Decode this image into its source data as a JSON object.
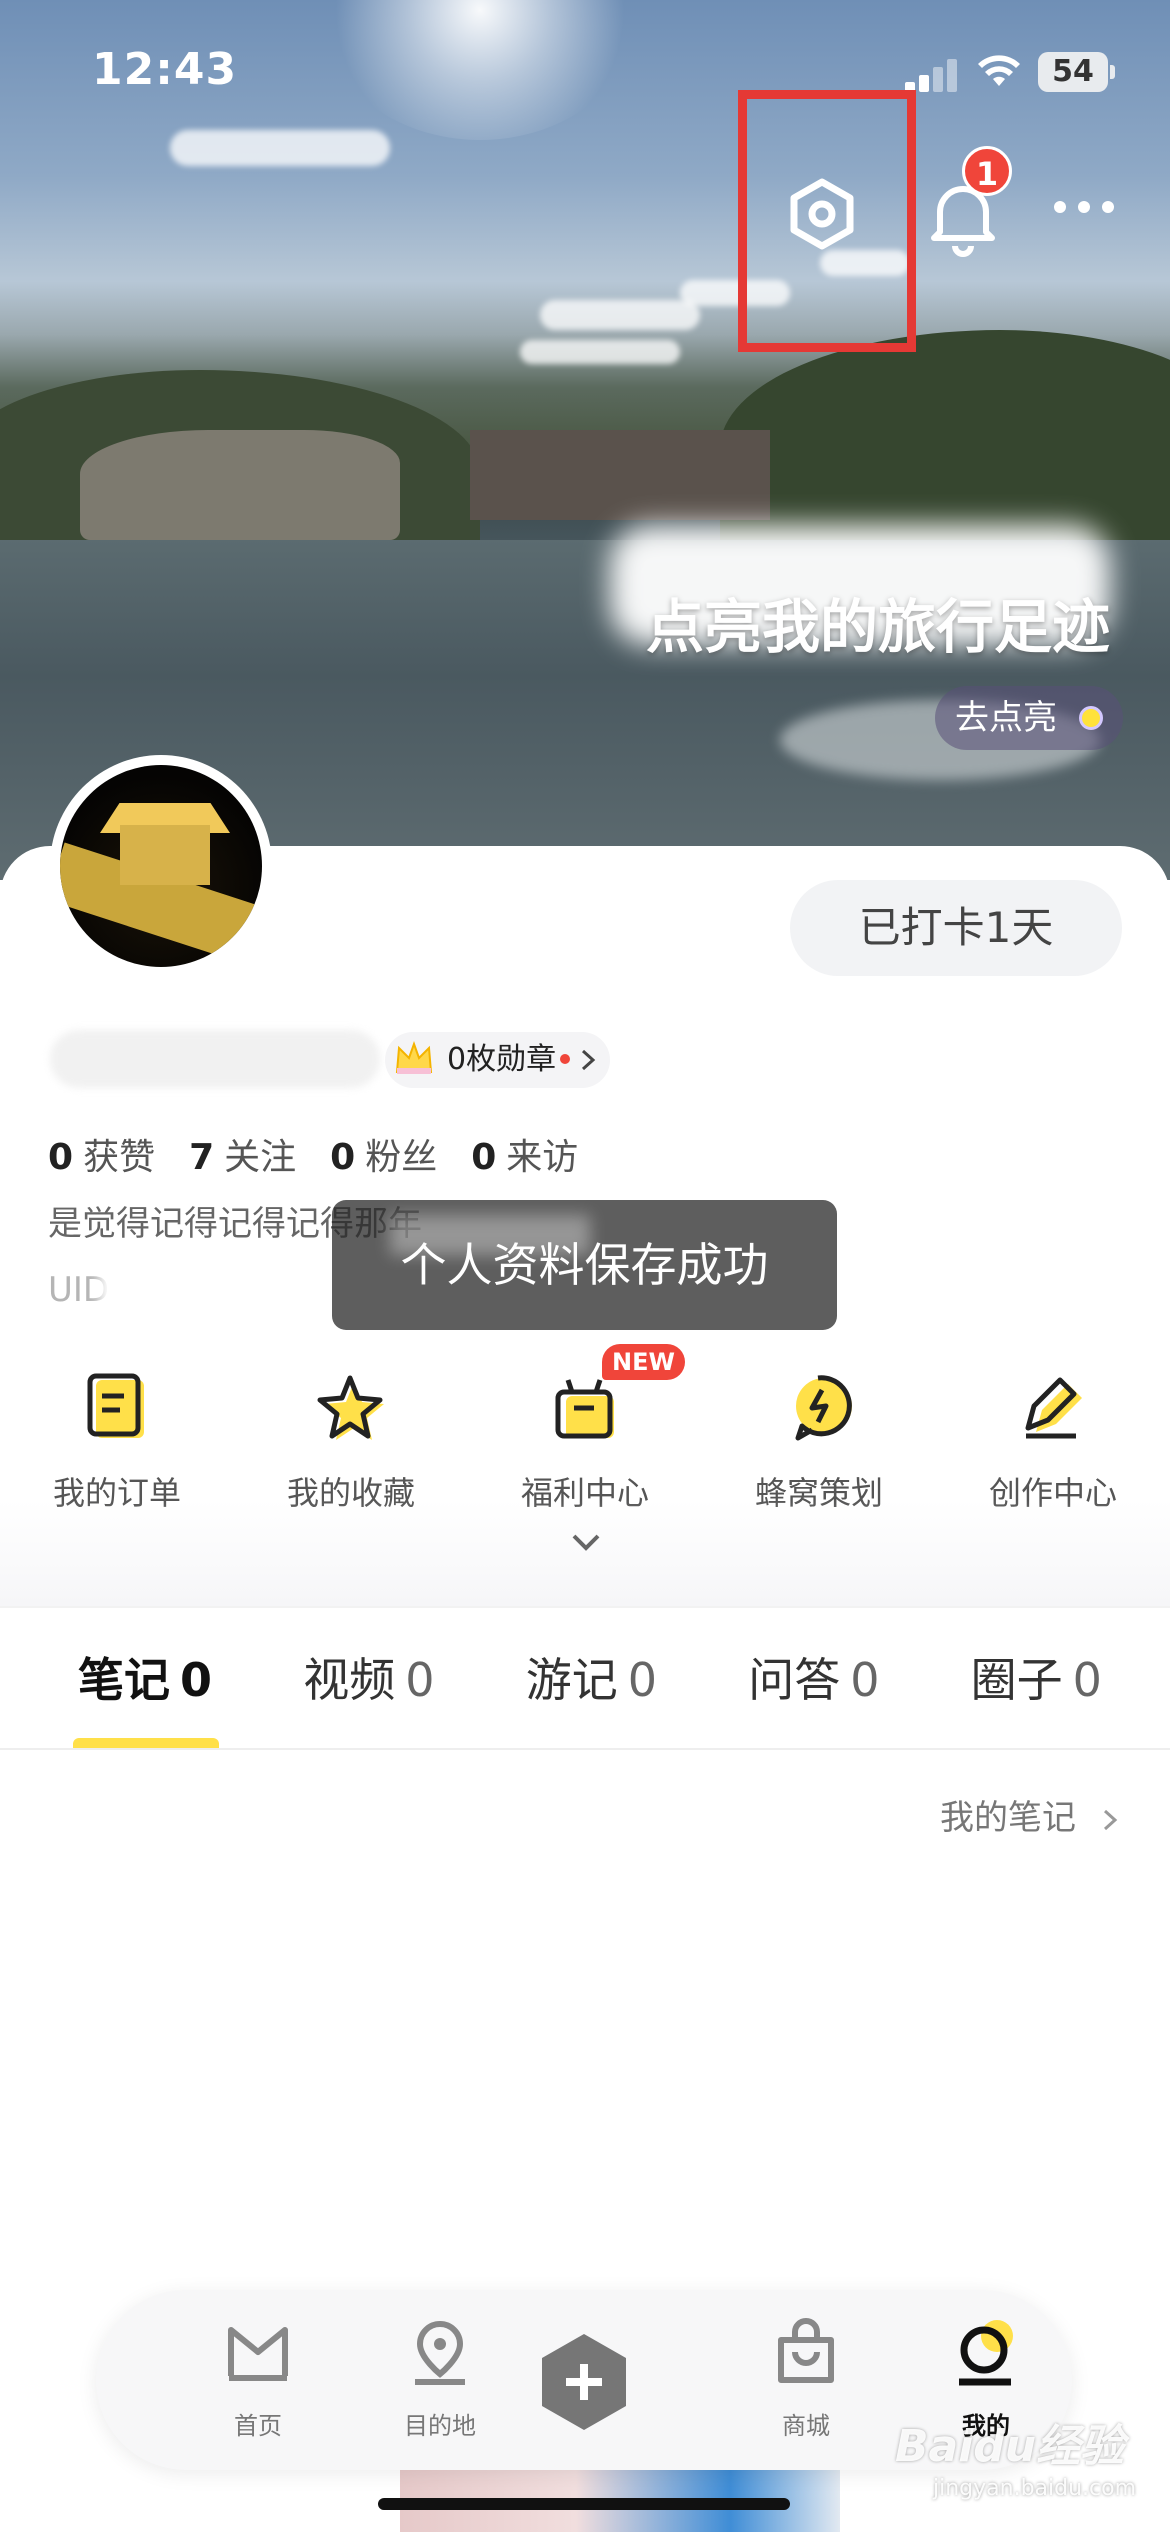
{
  "status_bar": {
    "time": "12:43",
    "battery": "54"
  },
  "header": {
    "notification_count": "1"
  },
  "hero": {
    "title": "点亮我的旅行足迹",
    "cta_label": "去点亮"
  },
  "profile": {
    "checkin_label": "已打卡1天",
    "medal_label": "0枚勋章",
    "stats": [
      {
        "value": "0",
        "label": "获赞"
      },
      {
        "value": "7",
        "label": "关注"
      },
      {
        "value": "0",
        "label": "粉丝"
      },
      {
        "value": "0",
        "label": "来访"
      }
    ],
    "bio": "是觉得记得记得记得那年",
    "uid_prefix": "UID"
  },
  "toast": {
    "message": "个人资料保存成功"
  },
  "quick_actions": [
    {
      "label": "我的订单",
      "icon": "order-icon"
    },
    {
      "label": "我的收藏",
      "icon": "star-icon"
    },
    {
      "label": "福利中心",
      "icon": "gift-icon",
      "badge": "NEW"
    },
    {
      "label": "蜂窝策划",
      "icon": "bee-icon"
    },
    {
      "label": "创作中心",
      "icon": "pen-icon"
    }
  ],
  "tabs": [
    {
      "label": "笔记",
      "count": "0",
      "active": true
    },
    {
      "label": "视频",
      "count": "0"
    },
    {
      "label": "游记",
      "count": "0"
    },
    {
      "label": "问答",
      "count": "0"
    },
    {
      "label": "圈子",
      "count": "0"
    }
  ],
  "section_link": "我的笔记",
  "bottom_nav": [
    {
      "label": "首页",
      "icon": "home-m-icon"
    },
    {
      "label": "目的地",
      "icon": "location-pin-icon"
    },
    {
      "label": "",
      "icon": "plus-icon"
    },
    {
      "label": "商城",
      "icon": "shopping-bag-icon"
    },
    {
      "label": "我的",
      "icon": "profile-icon",
      "active": true
    }
  ],
  "watermark": {
    "brand": "Baidu经验",
    "url": "jingyan.baidu.com"
  },
  "colors": {
    "accent_yellow": "#ffe049",
    "badge_red": "#f0453a",
    "highlight_red": "#e53935"
  }
}
